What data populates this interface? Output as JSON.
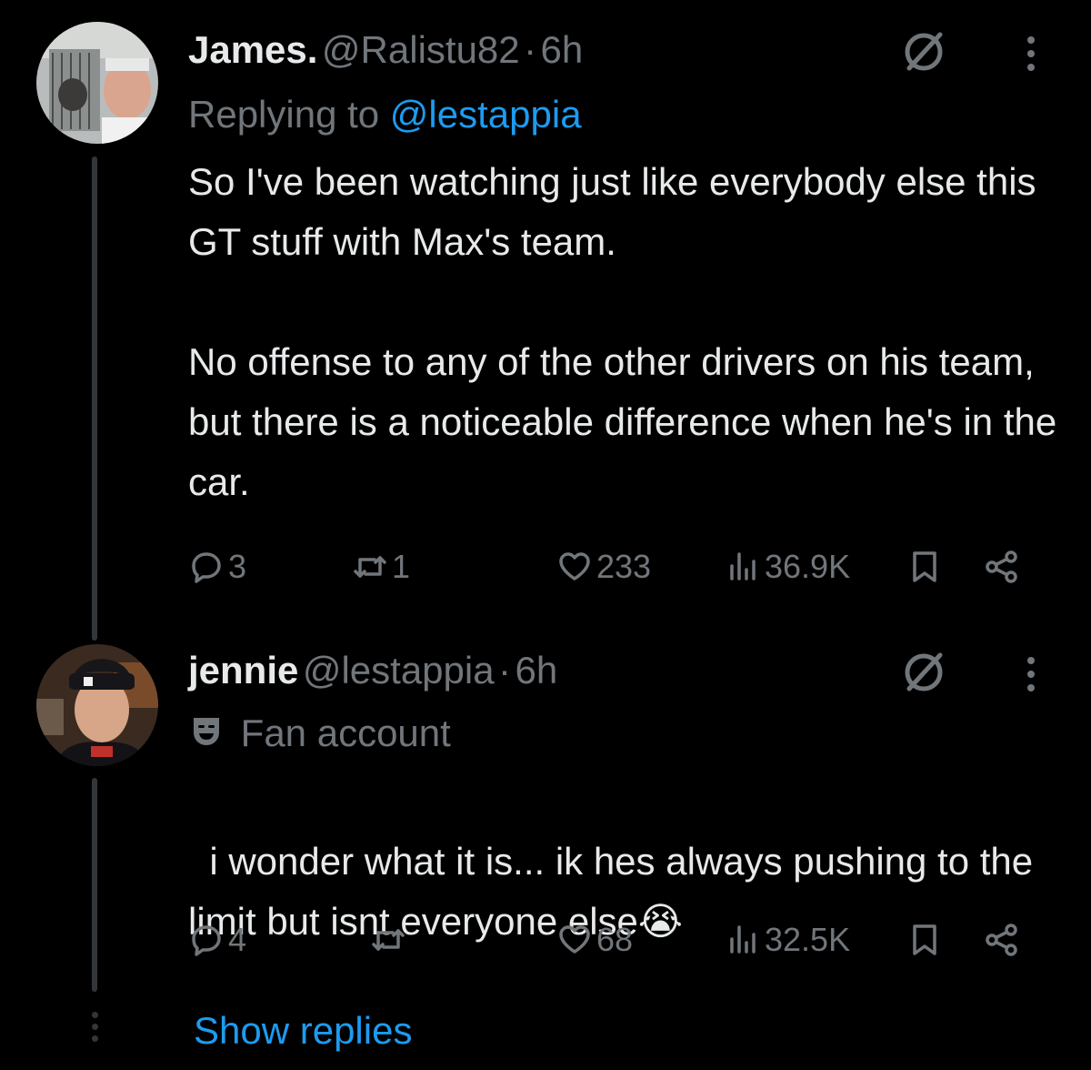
{
  "tweets": [
    {
      "display_name": "James.",
      "handle": "@Ralistu82",
      "separator": "·",
      "time": "6h",
      "replying_prefix": "Replying to",
      "replying_to": "@lestappia",
      "text": "So I've been watching just like everybody else this GT stuff with Max's team.\n\nNo offense to any of the other drivers on his team, but there is a noticeable difference when he's in the car.",
      "replies": "3",
      "reposts": "1",
      "likes": "233",
      "views": "36.9K"
    },
    {
      "display_name": "jennie",
      "handle": "@lestappia",
      "separator": "·",
      "time": "6h",
      "label_icon": "theater-mask-icon",
      "label": "Fan account",
      "text": "i wonder what it is... ik hes always pushing to the limit but isnt everyone else",
      "emoji": "😭",
      "replies": "4",
      "reposts": "",
      "likes": "68",
      "views": "32.5K"
    }
  ],
  "show_replies": "Show replies",
  "colors": {
    "background": "#000000",
    "text": "#e7e9ea",
    "muted": "#71767b",
    "accent": "#1d9bf0"
  }
}
